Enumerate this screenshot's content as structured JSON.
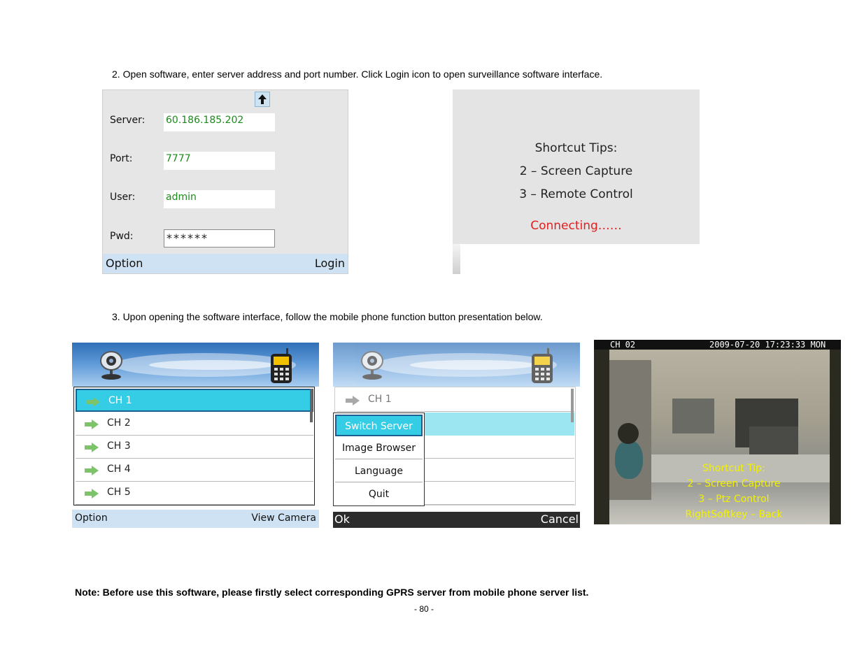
{
  "step2": "2. Open software, enter server address and port number. Click Login icon to open surveillance software interface.",
  "step3": "3. Upon opening the software interface, follow the mobile phone function button presentation below.",
  "note": "Note: Before use this software, please firstly select corresponding GPRS server from mobile phone server list.",
  "page_number": "- 80 -",
  "login_screen": {
    "server_label": "Server:",
    "server_value": "60.186.185.202",
    "port_label": "Port:",
    "port_value": "7777",
    "user_label": "User:",
    "user_value": "admin",
    "pwd_label": "Pwd:",
    "pwd_value": "******",
    "left_softkey": "Option",
    "right_softkey": "Login",
    "up_icon": "arrow-up-icon"
  },
  "tips_screen": {
    "title": "Shortcut Tips:",
    "tip1": "2 – Screen Capture",
    "tip2": "3 – Remote Control",
    "status": "Connecting……",
    "status_color": "#e02020"
  },
  "channel_screen": {
    "channels": [
      "CH 1",
      "CH 2",
      "CH 3",
      "CH 4",
      "CH 5"
    ],
    "selected_index": 0,
    "left_softkey": "Option",
    "right_softkey": "View Camera",
    "highlight_color": "#35cde6"
  },
  "menu_screen": {
    "first_channel": "CH 1",
    "menu_items": [
      "Switch Server",
      "Image Browser",
      "Language",
      "Quit"
    ],
    "selected_index": 0,
    "left_softkey": "Ok",
    "right_softkey": "Cancel"
  },
  "camera_screen": {
    "channel": "CH 02",
    "datetime": "2009-07-20 17:23:33 MON",
    "overlay_title": "Shortcut Tip:",
    "overlay_1": "2 – Screen Capture",
    "overlay_2": "3 – Ptz Control",
    "overlay_3": "RightSoftkey – Back",
    "overlay_color": "#f2f200"
  }
}
